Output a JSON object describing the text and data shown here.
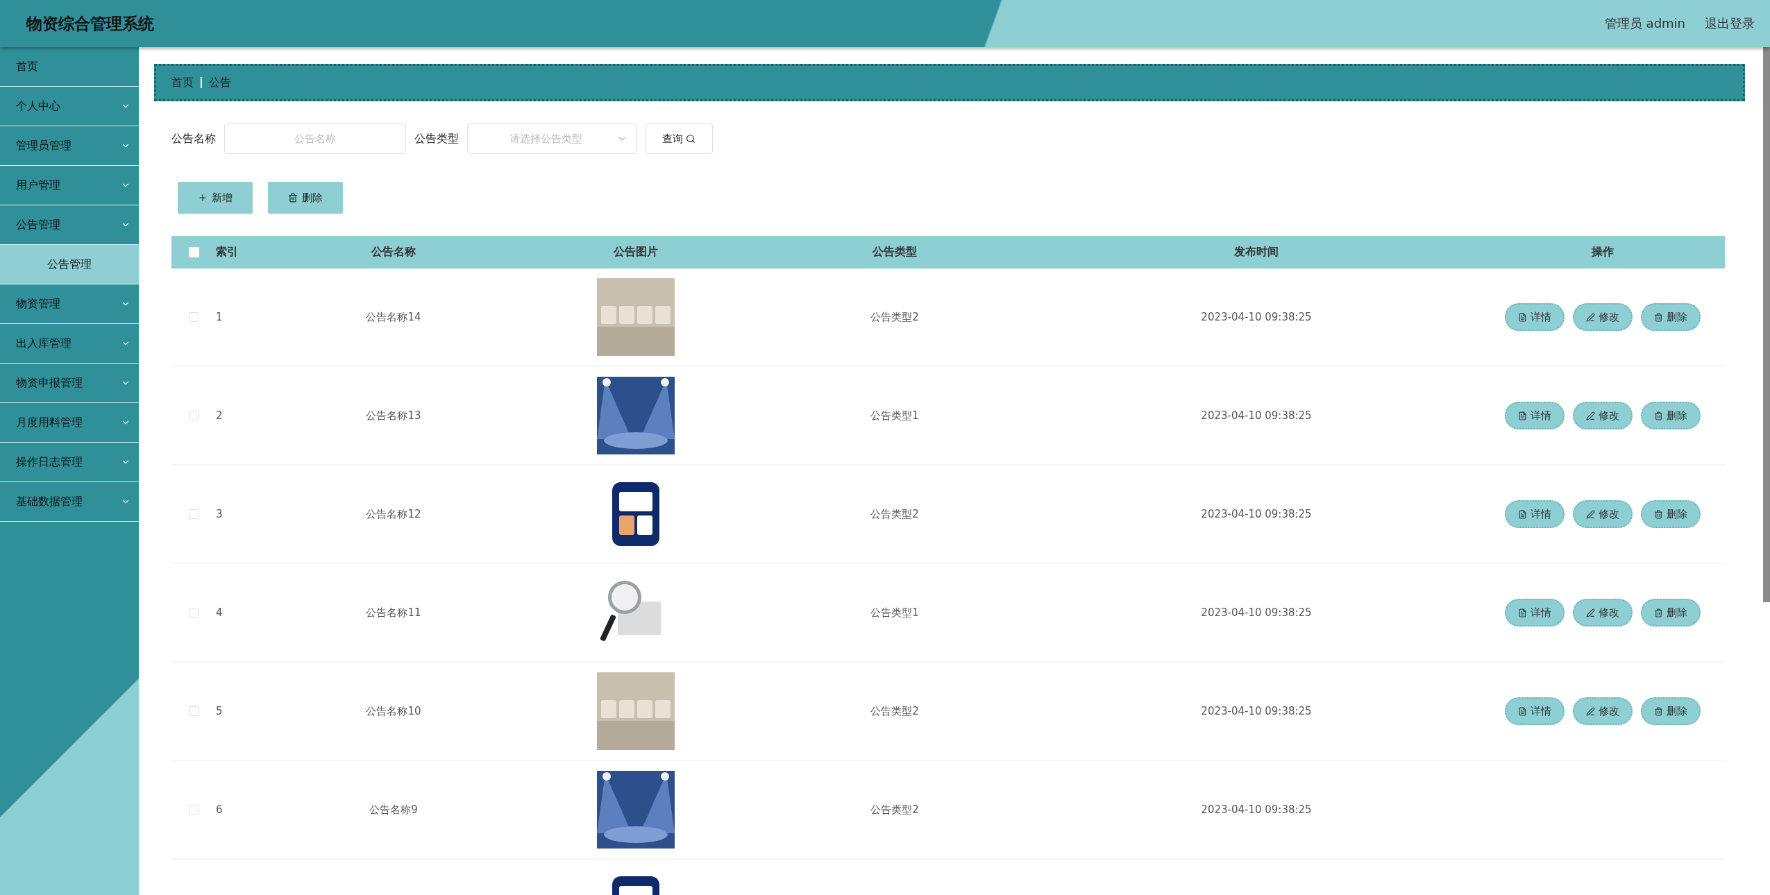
{
  "header": {
    "title": "物资综合管理系统",
    "user": "管理员 admin",
    "logout": "退出登录"
  },
  "sidebar": {
    "items": [
      {
        "label": "首页",
        "expandable": false
      },
      {
        "label": "个人中心",
        "expandable": true
      },
      {
        "label": "管理员管理",
        "expandable": true
      },
      {
        "label": "用户管理",
        "expandable": true
      },
      {
        "label": "公告管理",
        "expandable": true,
        "expanded": true,
        "children": [
          {
            "label": "公告管理",
            "selected": true
          }
        ]
      },
      {
        "label": "物资管理",
        "expandable": true
      },
      {
        "label": "出入库管理",
        "expandable": true
      },
      {
        "label": "物资申报管理",
        "expandable": true
      },
      {
        "label": "月度用料管理",
        "expandable": true
      },
      {
        "label": "操作日志管理",
        "expandable": true
      },
      {
        "label": "基础数据管理",
        "expandable": true
      }
    ]
  },
  "breadcrumb": [
    "首页",
    "公告"
  ],
  "filters": {
    "name_label": "公告名称",
    "name_placeholder": "公告名称",
    "type_label": "公告类型",
    "type_placeholder": "请选择公告类型",
    "query": "查询"
  },
  "toolbar": [
    {
      "kind": "add",
      "label": "新增"
    },
    {
      "kind": "delete",
      "label": "删除"
    }
  ],
  "table": {
    "columns": [
      "索引",
      "公告名称",
      "公告图片",
      "公告类型",
      "发布时间",
      "操作"
    ],
    "all_checked": false,
    "rows": [
      {
        "checked": false,
        "index": "1",
        "name": "公告名称14",
        "picture": {
          "kind": "picture"
        },
        "type": "公告类型2",
        "time": "2023-04-10 09:38:25",
        "actions": [
          {
            "kind": "detail",
            "label": "详情"
          },
          {
            "kind": "edit",
            "label": "修改"
          },
          {
            "kind": "delete",
            "label": "删除"
          }
        ]
      },
      {
        "checked": false,
        "index": "2",
        "name": "公告名称13",
        "picture": {
          "kind": "picture"
        },
        "type": "公告类型1",
        "time": "2023-04-10 09:38:25",
        "actions": [
          {
            "kind": "detail",
            "label": "详情"
          },
          {
            "kind": "edit",
            "label": "修改"
          },
          {
            "kind": "delete",
            "label": "删除"
          }
        ]
      },
      {
        "checked": false,
        "index": "3",
        "name": "公告名称12",
        "picture": {
          "kind": "picture"
        },
        "type": "公告类型2",
        "time": "2023-04-10 09:38:25",
        "actions": [
          {
            "kind": "detail",
            "label": "详情"
          },
          {
            "kind": "edit",
            "label": "修改"
          },
          {
            "kind": "delete",
            "label": "删除"
          }
        ]
      },
      {
        "checked": false,
        "index": "4",
        "name": "公告名称11",
        "picture": {
          "kind": "picture"
        },
        "type": "公告类型1",
        "time": "2023-04-10 09:38:25",
        "actions": [
          {
            "kind": "detail",
            "label": "详情"
          },
          {
            "kind": "edit",
            "label": "修改"
          },
          {
            "kind": "delete",
            "label": "删除"
          }
        ]
      },
      {
        "checked": false,
        "index": "5",
        "name": "公告名称10",
        "picture": {
          "kind": "picture"
        },
        "type": "公告类型2",
        "time": "2023-04-10 09:38:25",
        "actions": [
          {
            "kind": "detail",
            "label": "详情"
          },
          {
            "kind": "edit",
            "label": "修改"
          },
          {
            "kind": "delete",
            "label": "删除"
          }
        ]
      },
      {
        "checked": false,
        "index": "6",
        "name": "公告名称9",
        "picture": {
          "kind": "picture"
        },
        "type": "公告类型2",
        "time": "2023-04-10 09:38:25"
      },
      {
        "picture": {
          "kind": "picture"
        }
      }
    ]
  }
}
